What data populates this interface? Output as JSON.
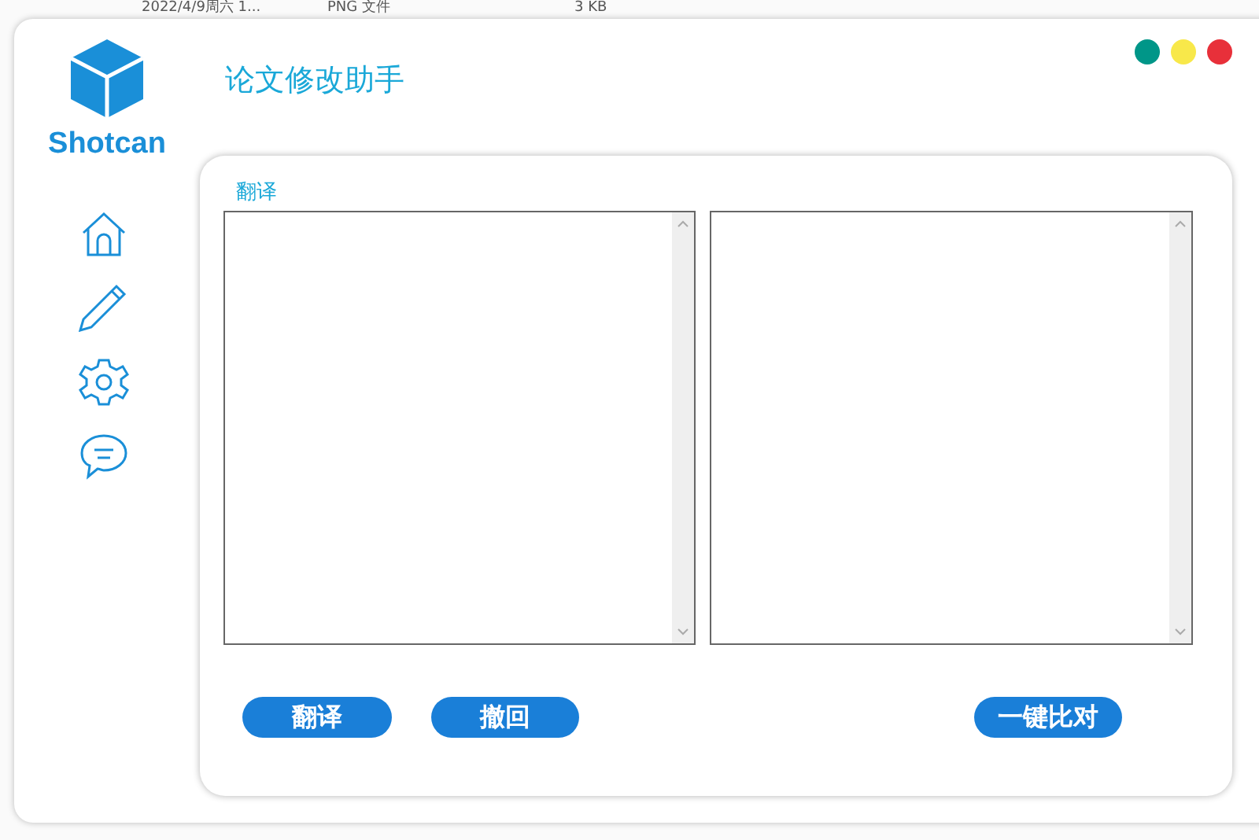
{
  "background_file_row": {
    "date": "2022/4/9周六 1...",
    "type": "PNG 文件",
    "size": "3 KB"
  },
  "window": {
    "logo_text": "Shotcan",
    "title": "论文修改助手",
    "controls": [
      {
        "color": "#009688"
      },
      {
        "color": "#f8e84a"
      },
      {
        "color": "#e8303a"
      }
    ]
  },
  "panel": {
    "label": "翻译",
    "buttons": [
      {
        "label": "翻译",
        "kind": "left"
      },
      {
        "label": "撤回",
        "kind": "left"
      },
      {
        "label": "一键比对",
        "kind": "right"
      }
    ]
  }
}
